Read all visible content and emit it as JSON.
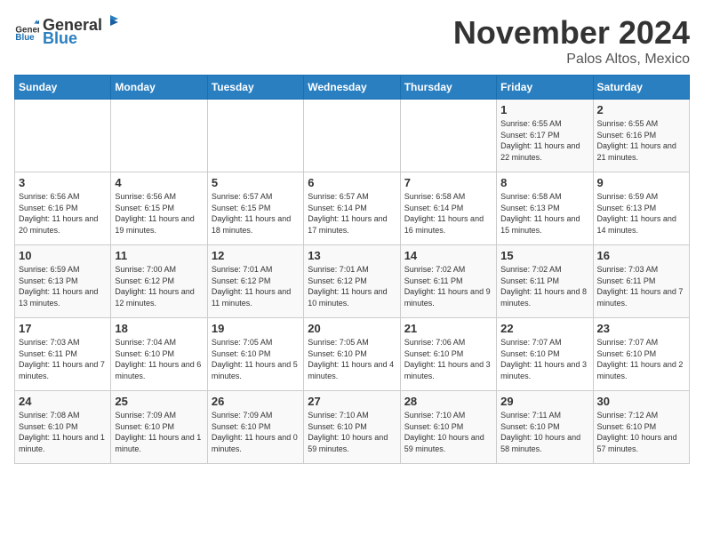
{
  "logo": {
    "general": "General",
    "blue": "Blue"
  },
  "header": {
    "month": "November 2024",
    "location": "Palos Altos, Mexico"
  },
  "days_of_week": [
    "Sunday",
    "Monday",
    "Tuesday",
    "Wednesday",
    "Thursday",
    "Friday",
    "Saturday"
  ],
  "weeks": [
    [
      {
        "day": "",
        "info": ""
      },
      {
        "day": "",
        "info": ""
      },
      {
        "day": "",
        "info": ""
      },
      {
        "day": "",
        "info": ""
      },
      {
        "day": "",
        "info": ""
      },
      {
        "day": "1",
        "info": "Sunrise: 6:55 AM\nSunset: 6:17 PM\nDaylight: 11 hours and 22 minutes."
      },
      {
        "day": "2",
        "info": "Sunrise: 6:55 AM\nSunset: 6:16 PM\nDaylight: 11 hours and 21 minutes."
      }
    ],
    [
      {
        "day": "3",
        "info": "Sunrise: 6:56 AM\nSunset: 6:16 PM\nDaylight: 11 hours and 20 minutes."
      },
      {
        "day": "4",
        "info": "Sunrise: 6:56 AM\nSunset: 6:15 PM\nDaylight: 11 hours and 19 minutes."
      },
      {
        "day": "5",
        "info": "Sunrise: 6:57 AM\nSunset: 6:15 PM\nDaylight: 11 hours and 18 minutes."
      },
      {
        "day": "6",
        "info": "Sunrise: 6:57 AM\nSunset: 6:14 PM\nDaylight: 11 hours and 17 minutes."
      },
      {
        "day": "7",
        "info": "Sunrise: 6:58 AM\nSunset: 6:14 PM\nDaylight: 11 hours and 16 minutes."
      },
      {
        "day": "8",
        "info": "Sunrise: 6:58 AM\nSunset: 6:13 PM\nDaylight: 11 hours and 15 minutes."
      },
      {
        "day": "9",
        "info": "Sunrise: 6:59 AM\nSunset: 6:13 PM\nDaylight: 11 hours and 14 minutes."
      }
    ],
    [
      {
        "day": "10",
        "info": "Sunrise: 6:59 AM\nSunset: 6:13 PM\nDaylight: 11 hours and 13 minutes."
      },
      {
        "day": "11",
        "info": "Sunrise: 7:00 AM\nSunset: 6:12 PM\nDaylight: 11 hours and 12 minutes."
      },
      {
        "day": "12",
        "info": "Sunrise: 7:01 AM\nSunset: 6:12 PM\nDaylight: 11 hours and 11 minutes."
      },
      {
        "day": "13",
        "info": "Sunrise: 7:01 AM\nSunset: 6:12 PM\nDaylight: 11 hours and 10 minutes."
      },
      {
        "day": "14",
        "info": "Sunrise: 7:02 AM\nSunset: 6:11 PM\nDaylight: 11 hours and 9 minutes."
      },
      {
        "day": "15",
        "info": "Sunrise: 7:02 AM\nSunset: 6:11 PM\nDaylight: 11 hours and 8 minutes."
      },
      {
        "day": "16",
        "info": "Sunrise: 7:03 AM\nSunset: 6:11 PM\nDaylight: 11 hours and 7 minutes."
      }
    ],
    [
      {
        "day": "17",
        "info": "Sunrise: 7:03 AM\nSunset: 6:11 PM\nDaylight: 11 hours and 7 minutes."
      },
      {
        "day": "18",
        "info": "Sunrise: 7:04 AM\nSunset: 6:10 PM\nDaylight: 11 hours and 6 minutes."
      },
      {
        "day": "19",
        "info": "Sunrise: 7:05 AM\nSunset: 6:10 PM\nDaylight: 11 hours and 5 minutes."
      },
      {
        "day": "20",
        "info": "Sunrise: 7:05 AM\nSunset: 6:10 PM\nDaylight: 11 hours and 4 minutes."
      },
      {
        "day": "21",
        "info": "Sunrise: 7:06 AM\nSunset: 6:10 PM\nDaylight: 11 hours and 3 minutes."
      },
      {
        "day": "22",
        "info": "Sunrise: 7:07 AM\nSunset: 6:10 PM\nDaylight: 11 hours and 3 minutes."
      },
      {
        "day": "23",
        "info": "Sunrise: 7:07 AM\nSunset: 6:10 PM\nDaylight: 11 hours and 2 minutes."
      }
    ],
    [
      {
        "day": "24",
        "info": "Sunrise: 7:08 AM\nSunset: 6:10 PM\nDaylight: 11 hours and 1 minute."
      },
      {
        "day": "25",
        "info": "Sunrise: 7:09 AM\nSunset: 6:10 PM\nDaylight: 11 hours and 1 minute."
      },
      {
        "day": "26",
        "info": "Sunrise: 7:09 AM\nSunset: 6:10 PM\nDaylight: 11 hours and 0 minutes."
      },
      {
        "day": "27",
        "info": "Sunrise: 7:10 AM\nSunset: 6:10 PM\nDaylight: 10 hours and 59 minutes."
      },
      {
        "day": "28",
        "info": "Sunrise: 7:10 AM\nSunset: 6:10 PM\nDaylight: 10 hours and 59 minutes."
      },
      {
        "day": "29",
        "info": "Sunrise: 7:11 AM\nSunset: 6:10 PM\nDaylight: 10 hours and 58 minutes."
      },
      {
        "day": "30",
        "info": "Sunrise: 7:12 AM\nSunset: 6:10 PM\nDaylight: 10 hours and 57 minutes."
      }
    ]
  ]
}
